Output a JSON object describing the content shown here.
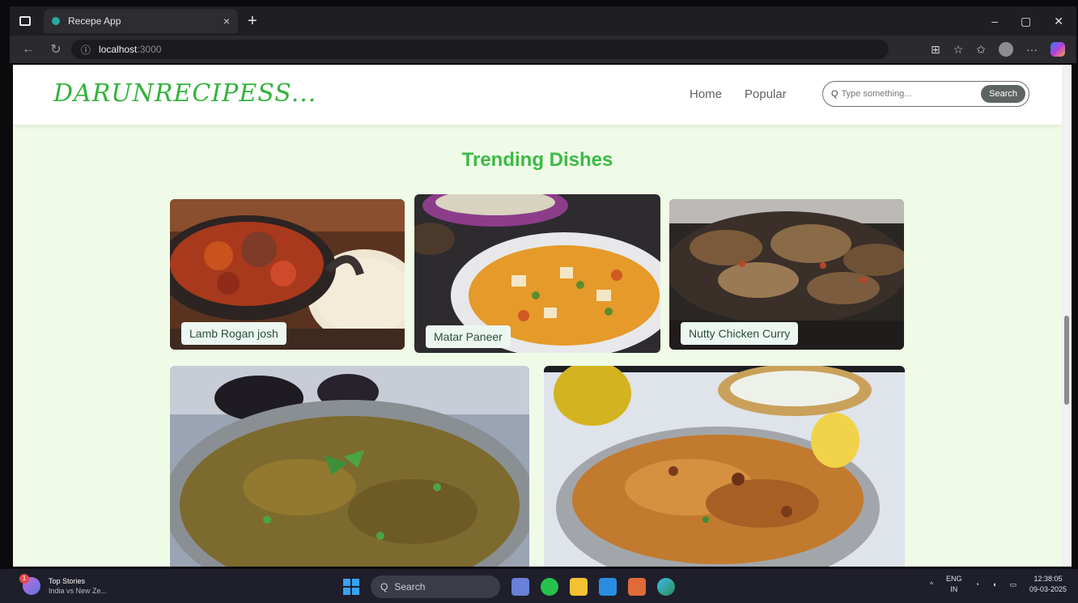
{
  "browser": {
    "tab_title": "Recepe App",
    "tab_close": "×",
    "new_tab": "+",
    "url_host": "localhost",
    "url_port": ":3000",
    "window_controls": [
      "–",
      "▢",
      "✕"
    ]
  },
  "site": {
    "logo": "DARUNRECIPESS...",
    "nav": [
      "Home",
      "Popular"
    ],
    "search_placeholder": "Type something...",
    "search_button": "Search",
    "section_title": "Trending Dishes",
    "dishes": [
      {
        "label": "Lamb Rogan josh",
        "icon": "lamb-rogan-josh-photo"
      },
      {
        "label": "Matar Paneer",
        "icon": "matar-paneer-photo"
      },
      {
        "label": "Nutty Chicken Curry",
        "icon": "nutty-chicken-curry-photo"
      },
      {
        "label": "",
        "icon": "baingan-bharta-photo"
      },
      {
        "label": "",
        "icon": "biryani-photo"
      }
    ]
  },
  "taskbar": {
    "news_title": "Top Stories",
    "news_sub": "India vs New Ze...",
    "news_badge": "1",
    "search": "Search",
    "lang_top": "ENG",
    "lang_bottom": "IN",
    "time": "12:38:05",
    "date": "09-03-2025"
  },
  "colors": {
    "accent_green": "#3cba47",
    "page_bg": "#effbe6"
  }
}
